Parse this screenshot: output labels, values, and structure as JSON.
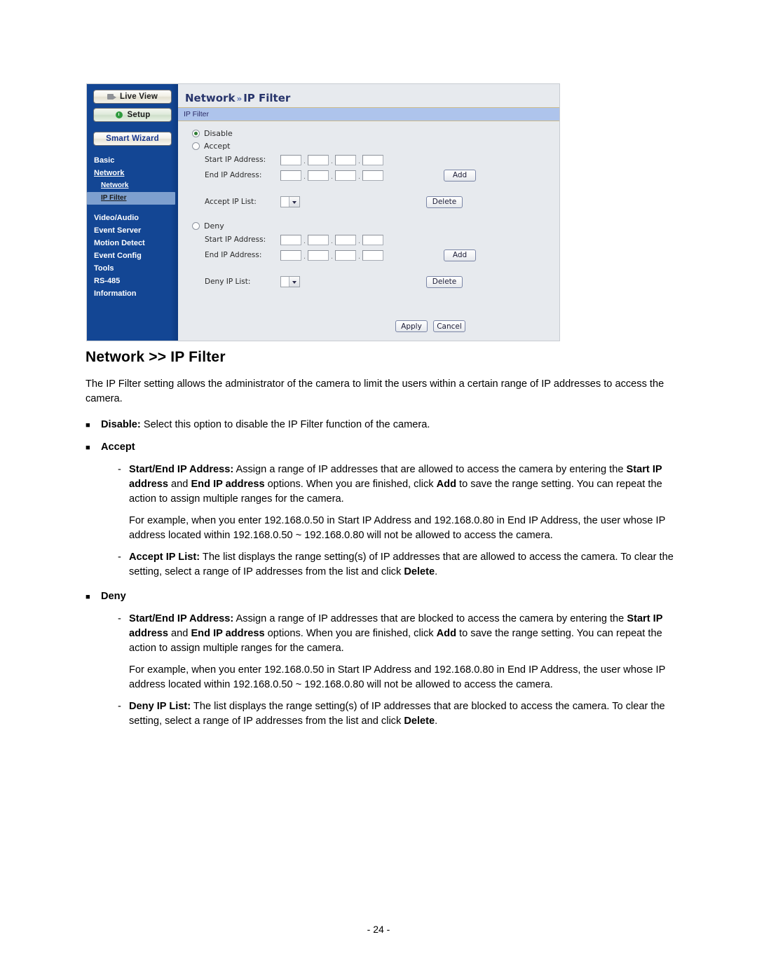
{
  "screenshot": {
    "sidebar": {
      "buttons": [
        {
          "label": "Live View",
          "icon": "camera-icon"
        },
        {
          "label": "Setup",
          "icon": "clock-icon"
        },
        {
          "label": "Smart Wizard",
          "icon": "none"
        }
      ],
      "menu": [
        {
          "label": "Basic",
          "level": "top",
          "state": "normal"
        },
        {
          "label": "Network",
          "level": "top",
          "state": "open"
        },
        {
          "label": "Network",
          "level": "sub",
          "state": "normal"
        },
        {
          "label": "IP Filter",
          "level": "sub",
          "state": "current"
        },
        {
          "label": "Video/Audio",
          "level": "top",
          "state": "normal"
        },
        {
          "label": "Event Server",
          "level": "top",
          "state": "normal"
        },
        {
          "label": "Motion Detect",
          "level": "top",
          "state": "normal"
        },
        {
          "label": "Event Config",
          "level": "top",
          "state": "normal"
        },
        {
          "label": "Tools",
          "level": "top",
          "state": "normal"
        },
        {
          "label": "RS-485",
          "level": "top",
          "state": "normal"
        },
        {
          "label": "Information",
          "level": "top",
          "state": "normal"
        }
      ]
    },
    "header": {
      "title_primary": "Network",
      "chevron": "»",
      "title_secondary": "IP Filter",
      "band_label": "IP Filter"
    },
    "form": {
      "disable_label": "Disable",
      "disable_selected": true,
      "accept_label": "Accept",
      "accept_selected": false,
      "deny_label": "Deny",
      "deny_selected": false,
      "start_ip_label": "Start IP Address:",
      "end_ip_label": "End IP Address:",
      "accept_list_label": "Accept IP List:",
      "deny_list_label": "Deny IP List:",
      "octet_values": [
        "",
        "",
        "",
        ""
      ],
      "separator": ".",
      "add_label": "Add",
      "delete_label": "Delete",
      "apply_label": "Apply",
      "cancel_label": "Cancel",
      "accept_list_selected": "",
      "deny_list_selected": ""
    },
    "colors": {
      "sidebar_blue": "#14489c",
      "panel_gray": "#e7eaee",
      "band_blue": "#aec4ec",
      "title_navy": "#27346b",
      "highlight": "#7ea0cf"
    }
  },
  "document": {
    "heading": "Network >> IP Filter",
    "intro": "The IP Filter setting allows the administrator of the camera to limit the users within a certain range of IP addresses to access the camera.",
    "bullets": [
      {
        "marker": "■",
        "term": "Disable:",
        "rest": " Select this option to disable the IP Filter function of the camera."
      },
      {
        "marker": "■",
        "term": "Accept",
        "rest": ""
      }
    ],
    "accept_items": [
      {
        "dash": "-",
        "term": "Start/End IP Address:",
        "rest_1": " Assign a range of IP addresses that are allowed to access the camera by entering the ",
        "bold_1": "Start IP address",
        "rest_2": " and ",
        "bold_2": "End IP address",
        "rest_3": " options. When you are finished, click ",
        "bold_3": "Add",
        "rest_4": " to save the range setting. You can repeat the action to assign multiple ranges for the camera."
      },
      {
        "dash": "-",
        "term": "Accept IP List:",
        "rest_1": " The list displays the range setting(s) of IP addresses that are allowed to access the camera. To clear the setting, select a range of IP addresses from the list and click ",
        "bold_1": "Delete",
        "rest_2": "."
      }
    ],
    "accept_example": "For example, when you enter 192.168.0.50 in Start IP Address and 192.168.0.80 in End IP Address, the user whose IP address located within 192.168.0.50 ~ 192.168.0.80 will not be allowed to access the camera.",
    "deny_bullet": {
      "marker": "■",
      "term": "Deny"
    },
    "deny_items": [
      {
        "dash": "-",
        "term": "Start/End IP Address:",
        "rest_1": " Assign a range of IP addresses that are blocked to access the camera by entering the ",
        "bold_1": "Start IP address",
        "rest_2": " and ",
        "bold_2": "End IP address",
        "rest_3": " options. When you are finished, click ",
        "bold_3": "Add",
        "rest_4": " to save the range setting. You can repeat the action to assign multiple ranges for the camera."
      },
      {
        "dash": "-",
        "term": "Deny IP List:",
        "rest_1": " The list displays the range setting(s) of IP addresses that are blocked to access the camera. To clear the setting, select a range of IP addresses from the list and click ",
        "bold_1": "Delete",
        "rest_2": "."
      }
    ],
    "deny_example": "For example, when you enter 192.168.0.50 in Start IP Address and 192.168.0.80 in End IP Address, the user whose IP address located within 192.168.0.50 ~ 192.168.0.80 will not be allowed to access the camera.",
    "page_number": "- 24 -"
  }
}
